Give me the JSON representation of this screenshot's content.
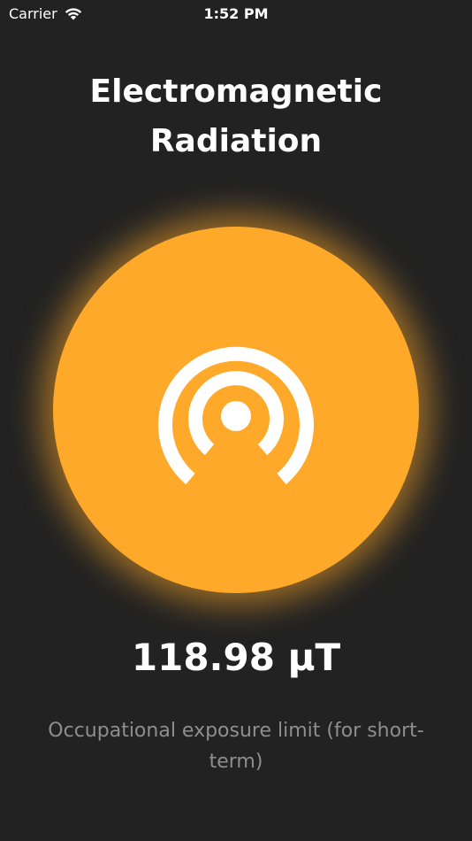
{
  "status_bar": {
    "carrier": "Carrier",
    "time": "1:52 PM"
  },
  "header": {
    "title": "Electromagnetic Radiation"
  },
  "indicator": {
    "icon": "radar-waves-icon",
    "color": "#ffa92a"
  },
  "reading": {
    "value": "118.98 µT",
    "description": "Occupational exposure limit (for short-term)"
  },
  "colors": {
    "background": "#222222",
    "accent": "#ffa92a",
    "secondary_text": "#8e8e8e"
  }
}
